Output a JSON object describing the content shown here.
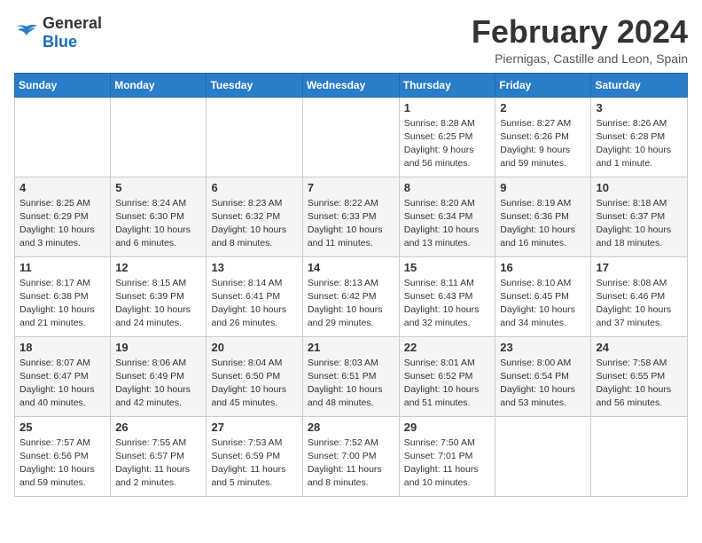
{
  "header": {
    "logo_general": "General",
    "logo_blue": "Blue",
    "month_year": "February 2024",
    "location": "Piernigas, Castille and Leon, Spain"
  },
  "days_of_week": [
    "Sunday",
    "Monday",
    "Tuesday",
    "Wednesday",
    "Thursday",
    "Friday",
    "Saturday"
  ],
  "weeks": [
    [
      {
        "day": "",
        "info": ""
      },
      {
        "day": "",
        "info": ""
      },
      {
        "day": "",
        "info": ""
      },
      {
        "day": "",
        "info": ""
      },
      {
        "day": "1",
        "info": "Sunrise: 8:28 AM\nSunset: 6:25 PM\nDaylight: 9 hours and 56 minutes."
      },
      {
        "day": "2",
        "info": "Sunrise: 8:27 AM\nSunset: 6:26 PM\nDaylight: 9 hours and 59 minutes."
      },
      {
        "day": "3",
        "info": "Sunrise: 8:26 AM\nSunset: 6:28 PM\nDaylight: 10 hours and 1 minute."
      }
    ],
    [
      {
        "day": "4",
        "info": "Sunrise: 8:25 AM\nSunset: 6:29 PM\nDaylight: 10 hours and 3 minutes."
      },
      {
        "day": "5",
        "info": "Sunrise: 8:24 AM\nSunset: 6:30 PM\nDaylight: 10 hours and 6 minutes."
      },
      {
        "day": "6",
        "info": "Sunrise: 8:23 AM\nSunset: 6:32 PM\nDaylight: 10 hours and 8 minutes."
      },
      {
        "day": "7",
        "info": "Sunrise: 8:22 AM\nSunset: 6:33 PM\nDaylight: 10 hours and 11 minutes."
      },
      {
        "day": "8",
        "info": "Sunrise: 8:20 AM\nSunset: 6:34 PM\nDaylight: 10 hours and 13 minutes."
      },
      {
        "day": "9",
        "info": "Sunrise: 8:19 AM\nSunset: 6:36 PM\nDaylight: 10 hours and 16 minutes."
      },
      {
        "day": "10",
        "info": "Sunrise: 8:18 AM\nSunset: 6:37 PM\nDaylight: 10 hours and 18 minutes."
      }
    ],
    [
      {
        "day": "11",
        "info": "Sunrise: 8:17 AM\nSunset: 6:38 PM\nDaylight: 10 hours and 21 minutes."
      },
      {
        "day": "12",
        "info": "Sunrise: 8:15 AM\nSunset: 6:39 PM\nDaylight: 10 hours and 24 minutes."
      },
      {
        "day": "13",
        "info": "Sunrise: 8:14 AM\nSunset: 6:41 PM\nDaylight: 10 hours and 26 minutes."
      },
      {
        "day": "14",
        "info": "Sunrise: 8:13 AM\nSunset: 6:42 PM\nDaylight: 10 hours and 29 minutes."
      },
      {
        "day": "15",
        "info": "Sunrise: 8:11 AM\nSunset: 6:43 PM\nDaylight: 10 hours and 32 minutes."
      },
      {
        "day": "16",
        "info": "Sunrise: 8:10 AM\nSunset: 6:45 PM\nDaylight: 10 hours and 34 minutes."
      },
      {
        "day": "17",
        "info": "Sunrise: 8:08 AM\nSunset: 6:46 PM\nDaylight: 10 hours and 37 minutes."
      }
    ],
    [
      {
        "day": "18",
        "info": "Sunrise: 8:07 AM\nSunset: 6:47 PM\nDaylight: 10 hours and 40 minutes."
      },
      {
        "day": "19",
        "info": "Sunrise: 8:06 AM\nSunset: 6:49 PM\nDaylight: 10 hours and 42 minutes."
      },
      {
        "day": "20",
        "info": "Sunrise: 8:04 AM\nSunset: 6:50 PM\nDaylight: 10 hours and 45 minutes."
      },
      {
        "day": "21",
        "info": "Sunrise: 8:03 AM\nSunset: 6:51 PM\nDaylight: 10 hours and 48 minutes."
      },
      {
        "day": "22",
        "info": "Sunrise: 8:01 AM\nSunset: 6:52 PM\nDaylight: 10 hours and 51 minutes."
      },
      {
        "day": "23",
        "info": "Sunrise: 8:00 AM\nSunset: 6:54 PM\nDaylight: 10 hours and 53 minutes."
      },
      {
        "day": "24",
        "info": "Sunrise: 7:58 AM\nSunset: 6:55 PM\nDaylight: 10 hours and 56 minutes."
      }
    ],
    [
      {
        "day": "25",
        "info": "Sunrise: 7:57 AM\nSunset: 6:56 PM\nDaylight: 10 hours and 59 minutes."
      },
      {
        "day": "26",
        "info": "Sunrise: 7:55 AM\nSunset: 6:57 PM\nDaylight: 11 hours and 2 minutes."
      },
      {
        "day": "27",
        "info": "Sunrise: 7:53 AM\nSunset: 6:59 PM\nDaylight: 11 hours and 5 minutes."
      },
      {
        "day": "28",
        "info": "Sunrise: 7:52 AM\nSunset: 7:00 PM\nDaylight: 11 hours and 8 minutes."
      },
      {
        "day": "29",
        "info": "Sunrise: 7:50 AM\nSunset: 7:01 PM\nDaylight: 11 hours and 10 minutes."
      },
      {
        "day": "",
        "info": ""
      },
      {
        "day": "",
        "info": ""
      }
    ]
  ]
}
